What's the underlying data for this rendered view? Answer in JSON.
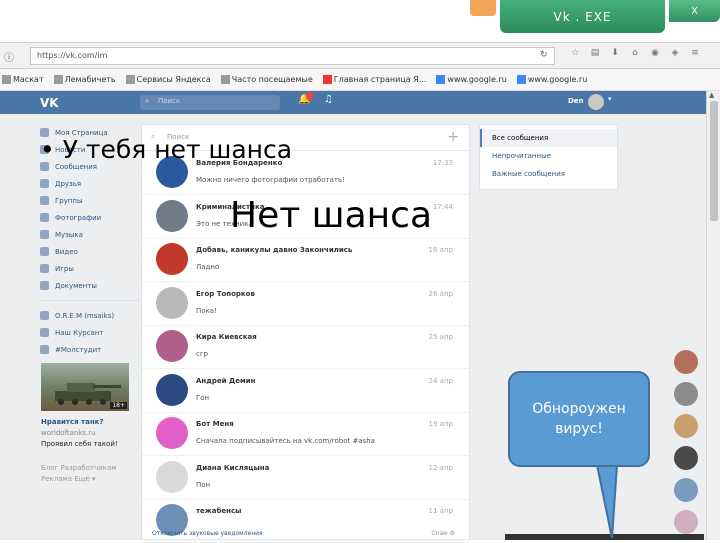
{
  "browser": {
    "tab_title": "Vk . EXE",
    "tab_close": "X",
    "url": "https://vk.com/im",
    "bookmarks": [
      "Маскат",
      "Лемабичеть",
      "Сервисы Яндекса",
      "Часто посещаемые",
      "Главная страница Я...",
      "www.google.ru",
      "www.google.ru"
    ]
  },
  "vk": {
    "logo": "VK",
    "search_placeholder": "Поиск",
    "user_name": "Den",
    "menu": [
      "Моя Страница",
      "Новости",
      "Сообщения",
      "Друзья",
      "Группы",
      "Фотографии",
      "Музыка",
      "Видео",
      "Игры",
      "Документы"
    ],
    "groups": [
      "O.R.E.M (msaiks)",
      "Наш Курсант",
      "#Молстудит"
    ],
    "ad_badge": "18+",
    "ad_text": [
      "Нравится танк?",
      "worldoftanks.ru",
      "Проявил себя такой!"
    ],
    "footer": [
      "Блог  Разработчикам",
      "Реклама  Ещё ▾"
    ],
    "dialogs_search": "Поиск",
    "dialogs": [
      {
        "name": "Валерия Бондаренко",
        "text": "Можно ничего фотографии отработать!",
        "time": "17:33",
        "color": "#2c5aa0"
      },
      {
        "name": "Криминалистика",
        "text": "Это не техника",
        "time": "17:44",
        "color": "#6f7c88"
      },
      {
        "name": "Добавь, каникулы давно Закончились",
        "text": "Ладно",
        "time": "16 апр",
        "color": "#c0392b"
      },
      {
        "name": "Егор Топорков",
        "text": "Пока!",
        "time": "26 апр",
        "color": "#b9b9b9"
      },
      {
        "name": "Кира Киевская",
        "text": "сгр",
        "time": "25 апр",
        "color": "#b0608a"
      },
      {
        "name": "Андрей Демин",
        "text": "Гон",
        "time": "24 апр",
        "color": "#2c4a82"
      },
      {
        "name": "Бот Меня",
        "text": "Сначала подписывайтесь на vk.com/robot   #asha",
        "time": "19 апр",
        "color": "#e05fc8"
      },
      {
        "name": "Диана Кисляцына",
        "text": "Пон",
        "time": "12 апр",
        "color": "#d9d9d9"
      },
      {
        "name": "тежабенсы",
        "text": "",
        "time": "11 апр",
        "color": "#6c8fb5"
      }
    ],
    "dialogs_bottom_left": "Отключить звуковые уведомления",
    "dialogs_bottom_right": "Спам",
    "right_panel": [
      "Все сообщения",
      "Непрочитанные",
      "Важные сообщения"
    ]
  },
  "overlay": {
    "bullet": "У тебя нет шанса",
    "big": "Нет шанса",
    "callout": "Обнороужен вирус!"
  }
}
